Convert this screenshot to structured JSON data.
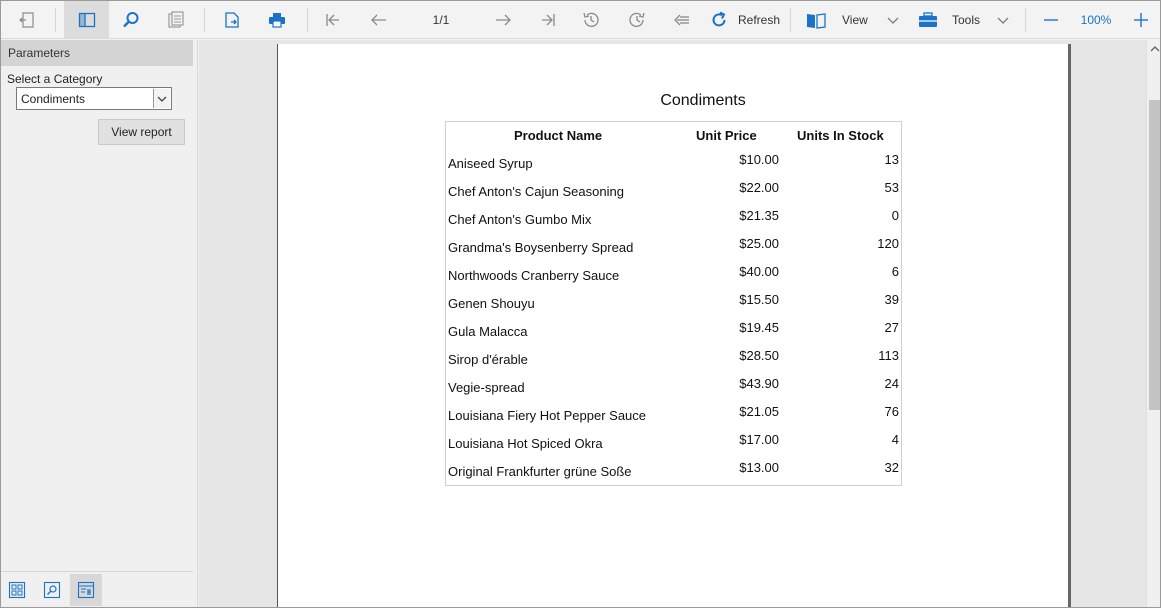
{
  "toolbar": {
    "page_indicator": "1/1",
    "refresh_label": "Refresh",
    "view_label": "View",
    "tools_label": "Tools",
    "zoom_level": "100%"
  },
  "parameters": {
    "header": "Parameters",
    "category_label": "Select a Category",
    "category_value": "Condiments",
    "view_report_label": "View report"
  },
  "report": {
    "title": "Condiments",
    "columns": [
      "Product Name",
      "Unit Price",
      "Units In Stock"
    ],
    "rows": [
      {
        "name": "Aniseed Syrup",
        "price": "$10.00",
        "stock": "13"
      },
      {
        "name": "Chef Anton's Cajun Seasoning",
        "price": "$22.00",
        "stock": "53"
      },
      {
        "name": "Chef Anton's Gumbo Mix",
        "price": "$21.35",
        "stock": "0"
      },
      {
        "name": "Grandma's Boysenberry Spread",
        "price": "$25.00",
        "stock": "120"
      },
      {
        "name": "Northwoods Cranberry Sauce",
        "price": "$40.00",
        "stock": "6"
      },
      {
        "name": "Genen Shouyu",
        "price": "$15.50",
        "stock": "39"
      },
      {
        "name": "Gula Malacca",
        "price": "$19.45",
        "stock": "27"
      },
      {
        "name": "Sirop d'érable",
        "price": "$28.50",
        "stock": "113"
      },
      {
        "name": "Vegie-spread",
        "price": "$43.90",
        "stock": "24"
      },
      {
        "name": "Louisiana Fiery Hot Pepper Sauce",
        "price": "$21.05",
        "stock": "76"
      },
      {
        "name": "Louisiana Hot Spiced Okra",
        "price": "$17.00",
        "stock": "4"
      },
      {
        "name": "Original Frankfurter grüne Soße",
        "price": "$13.00",
        "stock": "32"
      }
    ]
  },
  "colors": {
    "accent": "#1a73c8",
    "toolbar_icon": "#7a7a7a"
  }
}
